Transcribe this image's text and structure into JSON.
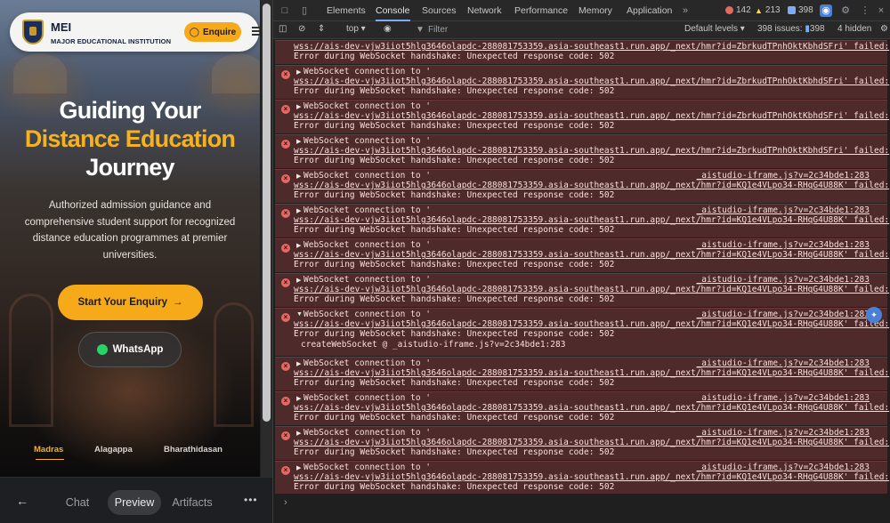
{
  "preview": {
    "brand_abbr": "MEI",
    "brand_full": "MAJOR EDUCATIONAL INSTITUTION",
    "enquire_label": "Enquire",
    "hero_line1": "Guiding Your",
    "hero_line2": "Distance Education",
    "hero_line3": "Journey",
    "description": "Authorized admission guidance and comprehensive student support for recognized distance education programmes at premier universities.",
    "start_label": "Start Your Enquiry",
    "whatsapp_label": "WhatsApp",
    "universities": [
      "Madras",
      "Alagappa",
      "Bharathidasan"
    ]
  },
  "bottom_bar": {
    "tabs": [
      "Chat",
      "Preview",
      "Artifacts"
    ],
    "active": "Preview"
  },
  "devtools": {
    "tabs": [
      "Elements",
      "Console",
      "Sources",
      "Network",
      "Performance",
      "Memory",
      "Application"
    ],
    "active_tab": "Console",
    "errors": "142",
    "warnings": "213",
    "info": "398",
    "context": "top",
    "filter_placeholder": "Filter",
    "levels": "Default levels",
    "issues": "398 issues:",
    "issues_count": "398",
    "hidden": "4 hidden"
  },
  "messages": [
    {
      "line1": "wss://ais-dev-vjw3iiot5hlg3646olapdc-288081753359.asia-southeast1.run.app/_next/hmr?id=ZbrkudTPnhOktKbhdSFri' failed:",
      "line2": "Error during WebSocket handshake: Unexpected response code: 502",
      "partial": true
    },
    {
      "head": "WebSocket connection to '",
      "line1": "wss://ais-dev-vjw3iiot5hlg3646olapdc-288081753359.asia-southeast1.run.app/_next/hmr?id=ZbrkudTPnhOktKbhdSFri' failed:",
      "line2": "Error during WebSocket handshake: Unexpected response code: 502",
      "src": ""
    },
    {
      "head": "WebSocket connection to '",
      "line1": "wss://ais-dev-vjw3iiot5hlg3646olapdc-288081753359.asia-southeast1.run.app/_next/hmr?id=ZbrkudTPnhOktKbhdSFri' failed:",
      "line2": "Error during WebSocket handshake: Unexpected response code: 502",
      "src": ""
    },
    {
      "head": "WebSocket connection to '",
      "line1": "wss://ais-dev-vjw3iiot5hlg3646olapdc-288081753359.asia-southeast1.run.app/_next/hmr?id=ZbrkudTPnhOktKbhdSFri' failed:",
      "line2": "Error during WebSocket handshake: Unexpected response code: 502",
      "src": ""
    },
    {
      "head": "WebSocket connection to '",
      "line1": "wss://ais-dev-vjw3iiot5hlg3646olapdc-288081753359.asia-southeast1.run.app/_next/hmr?id=KQ1e4VLpo34-RHqG4U88K' failed:",
      "line2": "Error during WebSocket handshake: Unexpected response code: 502",
      "src": "_aistudio-iframe.js?v=2c34bde1:283"
    },
    {
      "head": "WebSocket connection to '",
      "line1": "wss://ais-dev-vjw3iiot5hlg3646olapdc-288081753359.asia-southeast1.run.app/_next/hmr?id=KQ1e4VLpo34-RHqG4U88K' failed:",
      "line2": "Error during WebSocket handshake: Unexpected response code: 502",
      "src": "_aistudio-iframe.js?v=2c34bde1:283"
    },
    {
      "head": "WebSocket connection to '",
      "line1": "wss://ais-dev-vjw3iiot5hlg3646olapdc-288081753359.asia-southeast1.run.app/_next/hmr?id=KQ1e4VLpo34-RHqG4U88K' failed:",
      "line2": "Error during WebSocket handshake: Unexpected response code: 502",
      "src": "_aistudio-iframe.js?v=2c34bde1:283"
    },
    {
      "head": "WebSocket connection to '",
      "line1": "wss://ais-dev-vjw3iiot5hlg3646olapdc-288081753359.asia-southeast1.run.app/_next/hmr?id=KQ1e4VLpo34-RHqG4U88K' failed:",
      "line2": "Error during WebSocket handshake: Unexpected response code: 502",
      "src": "_aistudio-iframe.js?v=2c34bde1:283"
    },
    {
      "head": "WebSocket connection to '",
      "line1": "wss://ais-dev-vjw3iiot5hlg3646olapdc-288081753359.asia-southeast1.run.app/_next/hmr?id=KQ1e4VLpo34-RHqG4U88K' failed:",
      "line2": "Error during WebSocket handshake: Unexpected response code: 502",
      "src": "_aistudio-iframe.js?v=2c34bde1:283",
      "expanded": true,
      "stack": "createWebSocket @ _aistudio-iframe.js?v=2c34bde1:283"
    },
    {
      "head": "WebSocket connection to '",
      "line1": "wss://ais-dev-vjw3iiot5hlg3646olapdc-288081753359.asia-southeast1.run.app/_next/hmr?id=KQ1e4VLpo34-RHqG4U88K' failed:",
      "line2": "Error during WebSocket handshake: Unexpected response code: 502",
      "src": "_aistudio-iframe.js?v=2c34bde1:283"
    },
    {
      "head": "WebSocket connection to '",
      "line1": "wss://ais-dev-vjw3iiot5hlg3646olapdc-288081753359.asia-southeast1.run.app/_next/hmr?id=KQ1e4VLpo34-RHqG4U88K' failed:",
      "line2": "Error during WebSocket handshake: Unexpected response code: 502",
      "src": "_aistudio-iframe.js?v=2c34bde1:283"
    },
    {
      "head": "WebSocket connection to '",
      "line1": "wss://ais-dev-vjw3iiot5hlg3646olapdc-288081753359.asia-southeast1.run.app/_next/hmr?id=KQ1e4VLpo34-RHqG4U88K' failed:",
      "line2": "Error during WebSocket handshake: Unexpected response code: 502",
      "src": "_aistudio-iframe.js?v=2c34bde1:283"
    },
    {
      "head": "WebSocket connection to '",
      "line1": "wss://ais-dev-vjw3iiot5hlg3646olapdc-288081753359.asia-southeast1.run.app/_next/hmr?id=KQ1e4VLpo34-RHqG4U88K' failed:",
      "line2": "Error during WebSocket handshake: Unexpected response code: 502",
      "src": "_aistudio-iframe.js?v=2c34bde1:283"
    }
  ],
  "colors": {
    "accent": "#f6a919",
    "error_bg": "#4e2a2a",
    "navy": "#1c2d5a"
  }
}
